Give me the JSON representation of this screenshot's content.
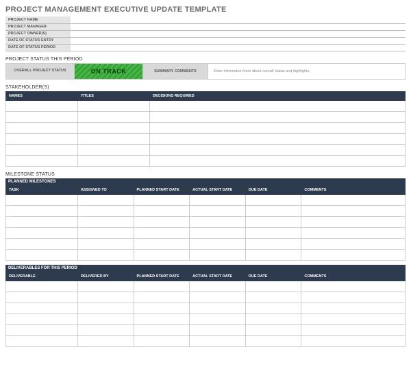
{
  "title": "PROJECT MANAGEMENT EXECUTIVE UPDATE TEMPLATE",
  "meta": {
    "labels": {
      "project_name": "PROJECT NAME",
      "project_manager": "PROJECT MANAGER",
      "project_owners": "PROJECT OWNER(S)",
      "date_status_entry": "DATE OF STATUS ENTRY",
      "date_status_period": "DATE OF STATUS PERIOD"
    },
    "values": {
      "project_name": "",
      "project_manager": "",
      "project_owners": "",
      "date_status_entry": "",
      "date_status_period": ""
    }
  },
  "status_section": {
    "heading": "PROJECT STATUS THIS PERIOD",
    "overall_label": "OVERALL PROJECT STATUS",
    "track_label": "ON TRACK",
    "summary_label": "SUMMARY COMMENTS",
    "comment_placeholder": "Enter information here about overall status and highlights."
  },
  "stakeholders": {
    "heading": "STAKEHOLDER(S)",
    "columns": {
      "names": "NAMES",
      "titles": "TITLES",
      "decisions": "DECISIONS REQUIRED"
    },
    "rows": [
      {
        "names": "",
        "titles": "",
        "decisions": ""
      },
      {
        "names": "",
        "titles": "",
        "decisions": ""
      },
      {
        "names": "",
        "titles": "",
        "decisions": ""
      },
      {
        "names": "",
        "titles": "",
        "decisions": ""
      },
      {
        "names": "",
        "titles": "",
        "decisions": ""
      },
      {
        "names": "",
        "titles": "",
        "decisions": ""
      }
    ]
  },
  "milestone": {
    "heading": "MILESTONE STATUS",
    "planned_sub": "PLANNED MILESTONES",
    "columns": {
      "task": "TASK",
      "assigned": "ASSIGNED TO",
      "planned_start": "PLANNED START DATE",
      "actual_start": "ACTUAL START DATE",
      "due": "DUE DATE",
      "comments": "COMMENTS"
    },
    "planned_rows": [
      {
        "task": "",
        "assigned": "",
        "planned_start": "",
        "actual_start": "",
        "due": "",
        "comments": ""
      },
      {
        "task": "",
        "assigned": "",
        "planned_start": "",
        "actual_start": "",
        "due": "",
        "comments": ""
      },
      {
        "task": "",
        "assigned": "",
        "planned_start": "",
        "actual_start": "",
        "due": "",
        "comments": ""
      },
      {
        "task": "",
        "assigned": "",
        "planned_start": "",
        "actual_start": "",
        "due": "",
        "comments": ""
      },
      {
        "task": "",
        "assigned": "",
        "planned_start": "",
        "actual_start": "",
        "due": "",
        "comments": ""
      },
      {
        "task": "",
        "assigned": "",
        "planned_start": "",
        "actual_start": "",
        "due": "",
        "comments": ""
      }
    ],
    "deliverables_sub": "DELIVERABLES FOR THIS PERIOD",
    "deliv_columns": {
      "deliverable": "DELIVERABLE",
      "delivered_by": "DELIVERED BY",
      "planned_start": "PLANNED START DATE",
      "actual_start": "ACTUAL START DATE",
      "due": "DUE DATE",
      "comments": "COMMENTS"
    },
    "deliv_rows": [
      {
        "deliverable": "",
        "delivered_by": "",
        "planned_start": "",
        "actual_start": "",
        "due": "",
        "comments": ""
      },
      {
        "deliverable": "",
        "delivered_by": "",
        "planned_start": "",
        "actual_start": "",
        "due": "",
        "comments": ""
      },
      {
        "deliverable": "",
        "delivered_by": "",
        "planned_start": "",
        "actual_start": "",
        "due": "",
        "comments": ""
      },
      {
        "deliverable": "",
        "delivered_by": "",
        "planned_start": "",
        "actual_start": "",
        "due": "",
        "comments": ""
      },
      {
        "deliverable": "",
        "delivered_by": "",
        "planned_start": "",
        "actual_start": "",
        "due": "",
        "comments": ""
      },
      {
        "deliverable": "",
        "delivered_by": "",
        "planned_start": "",
        "actual_start": "",
        "due": "",
        "comments": ""
      }
    ]
  }
}
